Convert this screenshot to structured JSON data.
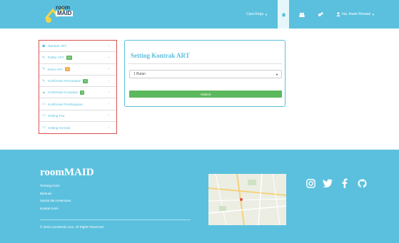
{
  "navbar": {
    "logo": {
      "line1": "room",
      "line2": "MAID"
    },
    "menu_label": "Cara Kerja",
    "home_icon": "home-icon",
    "user_label": "hai, Imam Renawi"
  },
  "sidebar": {
    "items": [
      {
        "icon": "person-icon",
        "label": "Tambah ART",
        "badge": "",
        "badge_color": ""
      },
      {
        "icon": "edit-icon",
        "label": "Daftar ART",
        "badge": "19",
        "badge_color": "#5cb85c"
      },
      {
        "icon": "edit-icon",
        "label": "Retur ART",
        "badge": "3",
        "badge_color": "#f0ad4e"
      },
      {
        "icon": "edit-icon",
        "label": "Konfirmasi Permintaan",
        "badge": "0",
        "badge_color": "#5cb85c"
      },
      {
        "icon": "warning-icon",
        "label": "Konfirmasi Komplain",
        "badge": "2",
        "badge_color": "#5cb85c"
      },
      {
        "icon": "card-icon",
        "label": "Konfirmasi Pembayaran",
        "badge": "",
        "badge_color": ""
      },
      {
        "icon": "card-icon",
        "label": "Setting Fee",
        "badge": "",
        "badge_color": ""
      },
      {
        "icon": "card-icon",
        "label": "Setting Kontrak",
        "badge": "",
        "badge_color": ""
      }
    ]
  },
  "panel": {
    "title": "Setting Kontrak ART",
    "select_value": "1 Bulan",
    "submit_label": "Submit"
  },
  "footer": {
    "brand": "roomMAID",
    "links": [
      "Tentang Kami",
      "Bantuan",
      "Syarat dan Ketentuan",
      "Kontak Kami"
    ],
    "copyright": "© 2016 roomMAID.com. All Rights Reserved",
    "socials": [
      "instagram-icon",
      "twitter-icon",
      "facebook-icon",
      "github-icon"
    ]
  },
  "colors": {
    "primary": "#5bc0de",
    "success": "#5cb85c",
    "warning": "#f0ad4e",
    "sidebar_border": "#d9534f"
  }
}
